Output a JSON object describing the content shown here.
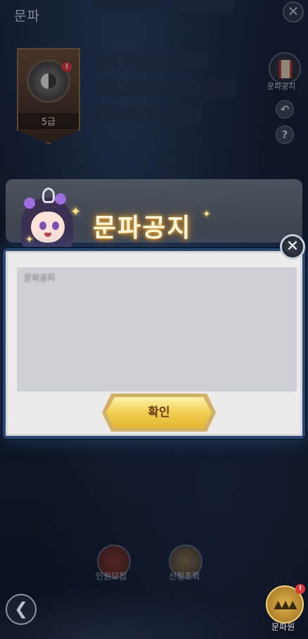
{
  "header": {
    "title": "문파",
    "close_icon": "close-icon"
  },
  "emblem": {
    "rank": "5급",
    "badge": "!"
  },
  "side_menu": {
    "notice_label": "문파공지",
    "notice_badge": "!",
    "back_icon": "undo-arrow-icon",
    "help_label": "?"
  },
  "modal": {
    "title": "문파공지",
    "notice_text": "문파공지",
    "confirm_label": "확인",
    "close_icon": "close-icon"
  },
  "bottom": {
    "recruit_label": "인원모집",
    "requests_label": "신청조회",
    "members_label": "문파원",
    "members_badge": "!"
  },
  "colors": {
    "accent_gold": "#f3d256",
    "modal_border": "#2b4772",
    "badge_red": "#e13434"
  }
}
